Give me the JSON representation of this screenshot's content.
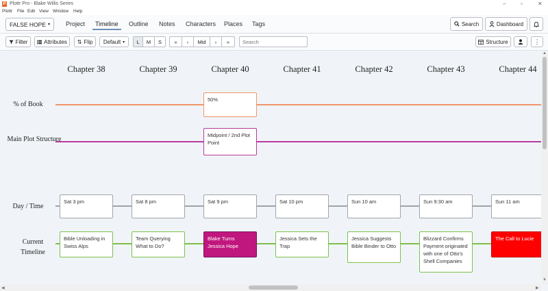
{
  "window": {
    "title": "Plottr Pro - Blake Willis Series",
    "app_icon": "P",
    "controls": [
      "–",
      "▫",
      "✕"
    ]
  },
  "menu": [
    "Plottr",
    "File",
    "Edit",
    "View",
    "Window",
    "Help"
  ],
  "nav": {
    "book_selector": "FALSE HOPE",
    "tabs": [
      "Project",
      "Timeline",
      "Outline",
      "Notes",
      "Characters",
      "Places",
      "Tags"
    ],
    "active_tab": "Timeline",
    "search_label": "Search",
    "dashboard_label": "Dashboard"
  },
  "toolbar": {
    "filter_label": "Filter",
    "attributes_label": "Attributes",
    "flip_label": "Flip",
    "default_label": "Default",
    "size_options": [
      "L",
      "M",
      "S"
    ],
    "size_selected": "L",
    "nav_mid_label": "Mid",
    "search_placeholder": "Search",
    "structure_label": "Structure"
  },
  "timeline": {
    "chapters": [
      "Chapter 38",
      "Chapter 39",
      "Chapter 40",
      "Chapter 41",
      "Chapter 42",
      "Chapter 43",
      "Chapter 44"
    ],
    "rows": [
      {
        "label": "% of Book",
        "color": "#f0956a"
      },
      {
        "label": "Main Plot Structure",
        "color": "#b8399e"
      },
      {
        "label": "Day / Time",
        "color": "#a0a4a8"
      },
      {
        "label": "Current Timeline",
        "color": "#7dbf4a"
      }
    ],
    "percent_cards": [
      {
        "chapter": "Chapter 40",
        "text": "50%"
      }
    ],
    "plot_cards": [
      {
        "chapter": "Chapter 40",
        "text": "Midpoint / 2nd Plot Point"
      }
    ],
    "day_cards": [
      "Sat 3 pm",
      "Sat 8 pm",
      "Sat 9 pm",
      "Sat 10 pm",
      "Sun 10 am",
      "Sun 9:30 am",
      "Sun 11 am"
    ],
    "timeline_cards": [
      {
        "text": "Bible Unloading in Swiss Alps",
        "style": "normal"
      },
      {
        "text": "Team Querying What to Do?",
        "style": "normal"
      },
      {
        "text": "Blake Turns Jessica Hope",
        "style": "magenta"
      },
      {
        "text": "Jessica Sets the Trap",
        "style": "normal"
      },
      {
        "text": "Jessica Suggests Bible Binder to Otto",
        "style": "normal"
      },
      {
        "text": "Blizzard Confirms Payment originated with one of Otto's Shell Companies",
        "style": "normal"
      },
      {
        "text": "The Call to Lucie",
        "style": "red"
      }
    ]
  }
}
